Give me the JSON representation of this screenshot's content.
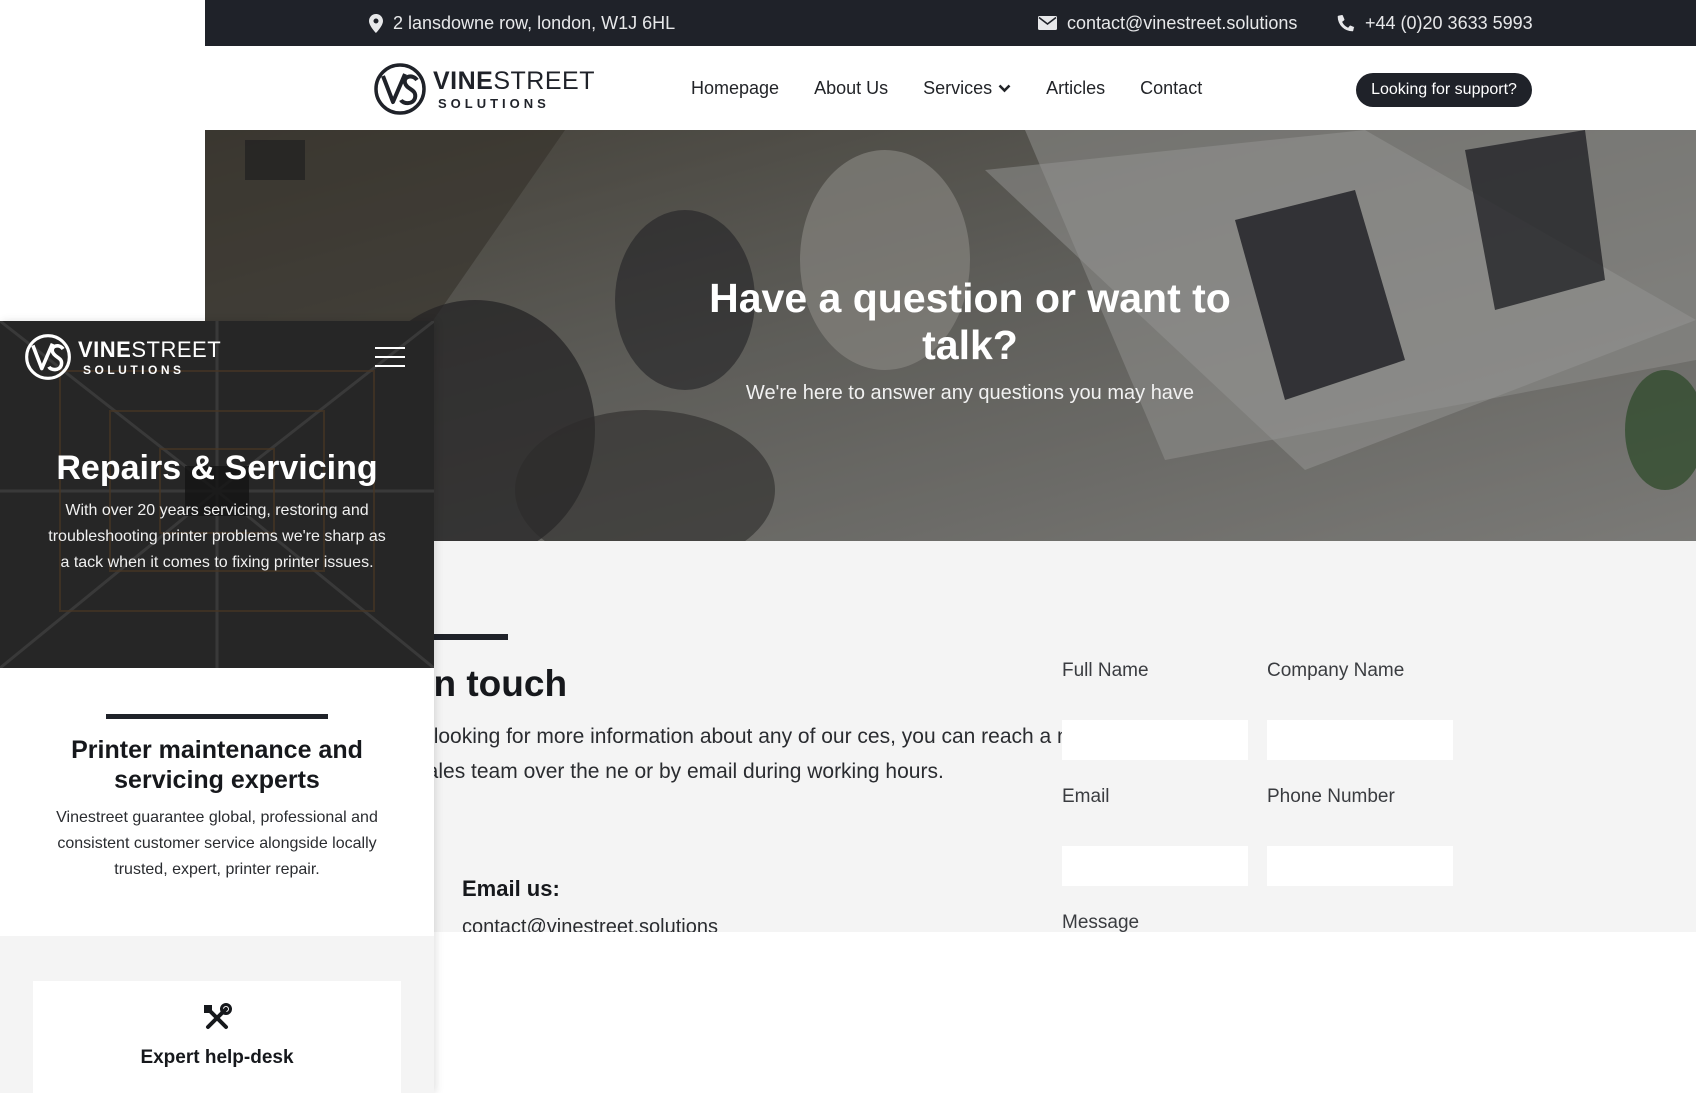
{
  "desktop": {
    "topbar": {
      "address": "2 lansdowne row, london, W1J 6HL",
      "email": "contact@vinestreet.solutions",
      "phone": "+44 (0)20 3633 5993"
    },
    "logo": {
      "word_bold": "VINE",
      "word_light": "STREET",
      "sub": "SOLUTIONS"
    },
    "nav": {
      "items": [
        {
          "label": "Homepage"
        },
        {
          "label": "About Us"
        },
        {
          "label": "Services"
        },
        {
          "label": "Articles"
        },
        {
          "label": "Contact"
        }
      ],
      "support_button": "Looking for support?"
    },
    "hero": {
      "title": "Have a question or want to talk?",
      "subtitle": "We're here to answer any questions you may have"
    },
    "contact": {
      "title": "et in touch",
      "body": "u are looking for more information about any of our ces, you can reach a member of our sales team over the ne or by email during working hours.",
      "email_label": "Email us:",
      "email_value": "contact@vinestreet.solutions"
    },
    "form": {
      "full_name_label": "Full Name",
      "company_name_label": "Company Name",
      "email_label": "Email",
      "phone_label": "Phone Number",
      "message_label": "Message"
    },
    "colors": {
      "dark": "#1f2229",
      "section_bg": "#f4f4f4"
    }
  },
  "mobile": {
    "logo": {
      "word_bold": "VINE",
      "word_light": "STREET",
      "sub": "SOLUTIONS"
    },
    "hero": {
      "title": "Repairs & Servicing",
      "body": "With over 20 years servicing, restoring and troubleshooting printer problems we're sharp as a tack when it comes to fixing printer issues."
    },
    "section": {
      "title": "Printer maintenance and servicing experts",
      "body": "Vinestreet guarantee global, professional and consistent customer service alongside locally trusted, expert, printer repair."
    },
    "card": {
      "icon": "tools-icon",
      "title": "Expert help-desk"
    }
  }
}
